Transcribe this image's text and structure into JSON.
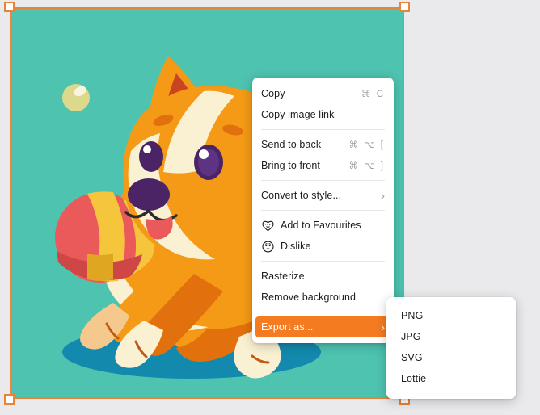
{
  "canvas": {
    "background_color": "#4ec3b0",
    "selection_color": "#e8833a",
    "page_background": "#eaeaec",
    "illustration": {
      "subject": "cartoon puppy playing with a striped ball",
      "fur_color": "#f49a16",
      "fur_shadow_color": "#e2700d",
      "muzzle_color": "#faf0d2",
      "eye_color": "#4b2465",
      "collar_color": "#1aa58d",
      "ball_red": "#ea5a5a",
      "ball_yellow": "#f5c63c",
      "ground_shadow_color": "#1389ad",
      "bubble_color": "#ddd98c"
    }
  },
  "context_menu": {
    "groups": [
      {
        "items": [
          {
            "label": "Copy",
            "shortcut": "⌘ C",
            "icon": null,
            "chevron": false,
            "highlight": false
          },
          {
            "label": "Copy image link",
            "shortcut": "",
            "icon": null,
            "chevron": false,
            "highlight": false
          }
        ]
      },
      {
        "items": [
          {
            "label": "Send to back",
            "shortcut": "⌘ ⌥ [",
            "icon": null,
            "chevron": false,
            "highlight": false
          },
          {
            "label": "Bring to front",
            "shortcut": "⌘ ⌥ ]",
            "icon": null,
            "chevron": false,
            "highlight": false
          }
        ]
      },
      {
        "items": [
          {
            "label": "Convert to style...",
            "shortcut": "",
            "icon": null,
            "chevron": true,
            "highlight": false
          }
        ]
      },
      {
        "items": [
          {
            "label": "Add to Favourites",
            "shortcut": "",
            "icon": "heart-face-icon",
            "chevron": false,
            "highlight": false
          },
          {
            "label": "Dislike",
            "shortcut": "",
            "icon": "sad-face-icon",
            "chevron": false,
            "highlight": false
          }
        ]
      },
      {
        "items": [
          {
            "label": "Rasterize",
            "shortcut": "",
            "icon": null,
            "chevron": false,
            "highlight": false
          },
          {
            "label": "Remove background",
            "shortcut": "",
            "icon": null,
            "chevron": false,
            "highlight": false
          }
        ]
      },
      {
        "items": [
          {
            "label": "Export as...",
            "shortcut": "",
            "icon": null,
            "chevron": true,
            "highlight": true
          }
        ]
      }
    ],
    "highlight_color": "#f47b20"
  },
  "export_submenu": {
    "items": [
      {
        "label": "PNG"
      },
      {
        "label": "JPG"
      },
      {
        "label": "SVG"
      },
      {
        "label": "Lottie"
      }
    ]
  }
}
